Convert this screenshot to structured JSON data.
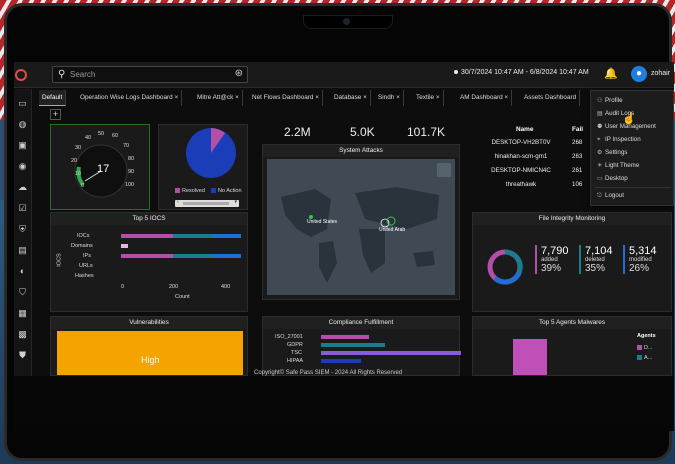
{
  "search": {
    "placeholder": "Search"
  },
  "header": {
    "date_range": "30/7/2024 10:47 AM - 6/8/2024 10:47 AM",
    "user_name": "zohair"
  },
  "tabs": [
    "Default",
    "Operation Wise Logs Dashboard ×",
    "Mitre Att@ck ×",
    "Net Flows Dashboard ×",
    "Database ×",
    "Sindh ×",
    "Textile ×",
    "AM Dashboard ×",
    "Assets Dashboard"
  ],
  "add_tab": "+",
  "gauge": {
    "value": "17",
    "ticks": [
      "10",
      "20",
      "30",
      "40",
      "50",
      "60",
      "70",
      "80",
      "90",
      "100",
      "0"
    ]
  },
  "pie": {
    "legend": [
      "Resolved",
      "No Action"
    ],
    "colors": {
      "resolved": "#b34fa8",
      "no_action": "#1a3db8"
    }
  },
  "stats": [
    "2.2M",
    "5.0K",
    "101.7K"
  ],
  "system_attacks": {
    "title": "System Attacks",
    "labels": [
      "United States",
      "United Arab"
    ]
  },
  "top_names": {
    "headers": [
      "Name",
      "Fail"
    ],
    "rows": [
      {
        "name": "DESKTOP-VH2BT0V",
        "value": "268"
      },
      {
        "name": "hinakhan-scm-gm1",
        "value": "263"
      },
      {
        "name": "DESKTOP-NMICN4C",
        "value": "261"
      },
      {
        "name": "threathawk",
        "value": "106"
      }
    ]
  },
  "top_iocs": {
    "title": "Top 5 IOCS",
    "y_label": "IOCS",
    "x_label": "Count",
    "categories": [
      "IOCs",
      "Domains",
      "IPs",
      "URLs",
      "Hashes"
    ],
    "x_ticks": [
      "0",
      "200",
      "400"
    ]
  },
  "fim": {
    "title": "File Integrity Monitoring",
    "items": [
      {
        "value": "7,790",
        "label": "added",
        "pct": "39%"
      },
      {
        "value": "7,104",
        "label": "deleted",
        "pct": "35%"
      },
      {
        "value": "5,314",
        "label": "modified",
        "pct": "26%"
      }
    ]
  },
  "vulnerabilities": {
    "title": "Vulnerabilities",
    "level": "High"
  },
  "compliance": {
    "title": "Compliance Fulfillment",
    "items": [
      "ISO_27001",
      "GDPR",
      "TSC",
      "HIPAA"
    ]
  },
  "malwares": {
    "title": "Top 5 Agents Malwares",
    "legend_title": "Agents",
    "legend": [
      "D...",
      "A..."
    ]
  },
  "copyright": "Copyright© Safe Pass SIEM - 2024 All Rights Reserved",
  "menu": [
    "Profile",
    "Audit Logs",
    "User Management",
    "IP Inspection",
    "Settings",
    "Light Theme",
    "Desktop",
    "Logout"
  ]
}
